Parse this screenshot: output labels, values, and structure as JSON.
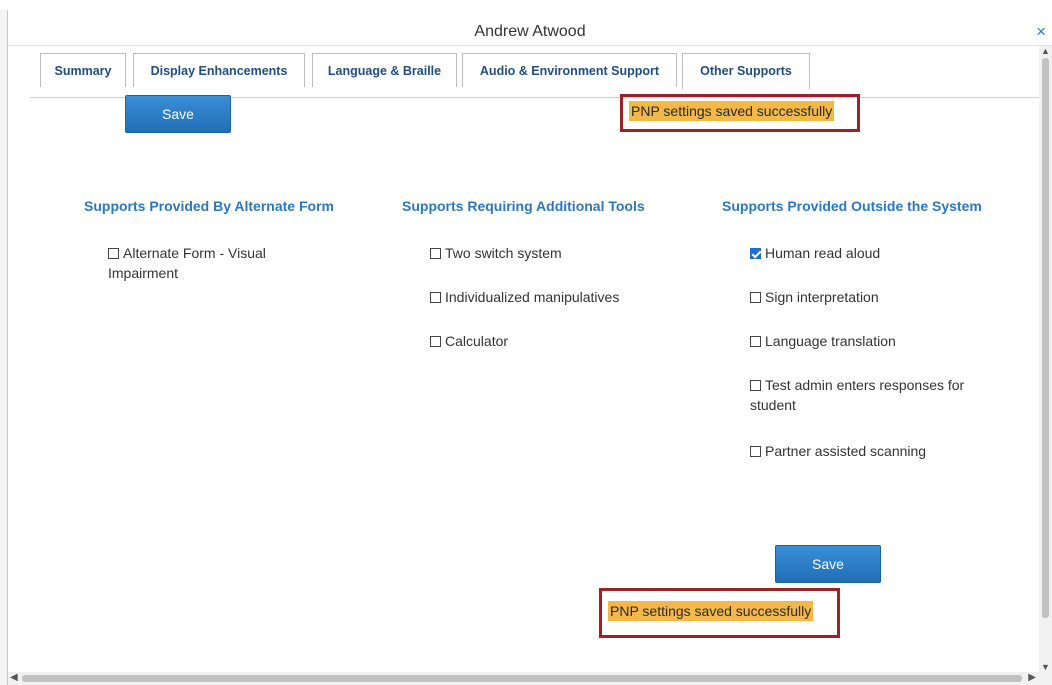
{
  "dialog": {
    "title": "Andrew Atwood",
    "close_label": "×"
  },
  "tabs": [
    {
      "label": "Summary",
      "active": false
    },
    {
      "label": "Display Enhancements",
      "active": false
    },
    {
      "label": "Language & Braille",
      "active": false
    },
    {
      "label": "Audio & Environment Support",
      "active": false
    },
    {
      "label": "Other Supports",
      "active": true
    }
  ],
  "actions": {
    "save_label": "Save",
    "saved_message": "PNP settings saved successfully"
  },
  "columns": [
    {
      "heading": "Supports Provided By Alternate Form",
      "options": [
        {
          "label": "Alternate Form - Visual Impairment",
          "checked": false
        }
      ]
    },
    {
      "heading": "Supports Requiring Additional Tools",
      "options": [
        {
          "label": "Two switch system",
          "checked": false
        },
        {
          "label": "Individualized manipulatives",
          "checked": false
        },
        {
          "label": "Calculator",
          "checked": false
        }
      ]
    },
    {
      "heading": "Supports Provided Outside the System",
      "options": [
        {
          "label": "Human read aloud",
          "checked": true
        },
        {
          "label": "Sign interpretation",
          "checked": false
        },
        {
          "label": "Language translation",
          "checked": false
        },
        {
          "label": "Test admin enters responses for student",
          "checked": false
        },
        {
          "label": "Partner assisted scanning",
          "checked": false
        }
      ]
    }
  ],
  "colors": {
    "accent": "#2a78c2",
    "save_button": "#2577c0",
    "highlight": "#f4b849",
    "outline": "#9b2226"
  }
}
